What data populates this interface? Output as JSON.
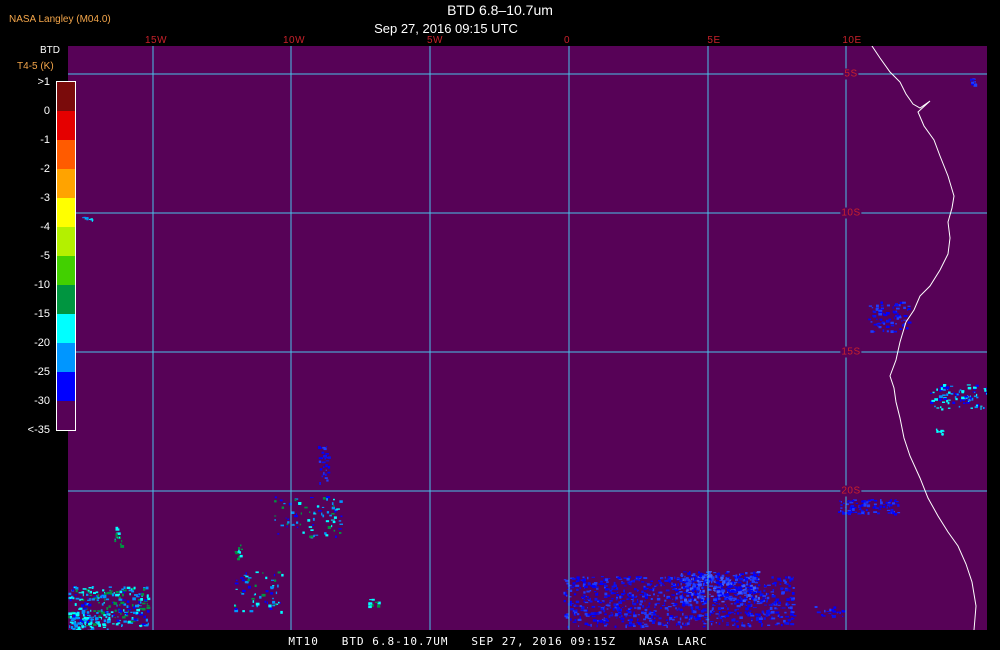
{
  "header": {
    "brand": "NASA Langley (M04.0)",
    "title": "BTD 6.8–10.7um",
    "subtitle": "Sep 27, 2016 09:15 UTC"
  },
  "map": {
    "background_color": "#570257",
    "grid_color": "#49c3ea",
    "coast_color": "#ffffff",
    "longitude_labels": [
      "15W",
      "10W",
      "5W",
      "0",
      "5E",
      "10E"
    ],
    "latitude_labels": [
      "5S",
      "10S",
      "15S",
      "20S"
    ],
    "label_color": "#c8212b"
  },
  "legend": {
    "title": "BTD",
    "units": "T4-5 (K)",
    "ticks": [
      ">1",
      "0",
      "-1",
      "-2",
      "-3",
      "-4",
      "-5",
      "-10",
      "-15",
      "-20",
      "-25",
      "-30",
      "<-35"
    ],
    "colors": [
      "#7a0b0b",
      "#e50000",
      "#ff5b00",
      "#ffa300",
      "#ffff00",
      "#b4f000",
      "#42d000",
      "#009540",
      "#00ffff",
      "#0096ff",
      "#0000ff",
      "#570257"
    ]
  },
  "footer": {
    "text": "MT10   BTD 6.8-10.7UM   SEP 27, 2016 09:15Z   NASA LARC"
  }
}
